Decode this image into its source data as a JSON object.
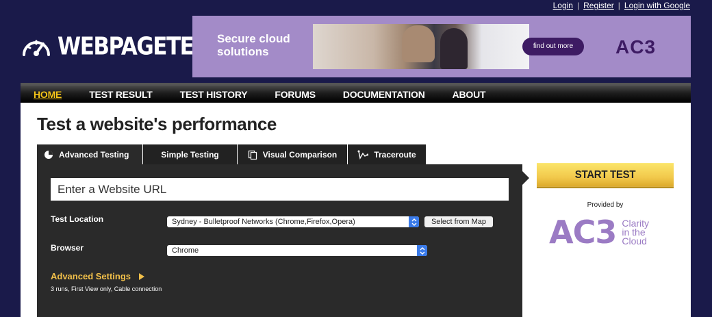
{
  "top_links": {
    "login": "Login",
    "register": "Register",
    "login_google": "Login with Google",
    "separator": "|"
  },
  "logo": {
    "text": "WEBPAGETEST"
  },
  "ad": {
    "headline_1": "Secure cloud",
    "headline_2": "solutions",
    "cta": "find out more",
    "brand": "AC3"
  },
  "nav": {
    "items": [
      {
        "label": "HOME",
        "active": true
      },
      {
        "label": "TEST RESULT"
      },
      {
        "label": "TEST HISTORY"
      },
      {
        "label": "FORUMS"
      },
      {
        "label": "DOCUMENTATION"
      },
      {
        "label": "ABOUT"
      }
    ]
  },
  "page": {
    "title": "Test a website's performance"
  },
  "tabs": [
    {
      "label": "Advanced Testing",
      "icon": "pie-chart-icon",
      "active": true
    },
    {
      "label": "Simple Testing"
    },
    {
      "label": "Visual Comparison",
      "icon": "documents-icon"
    },
    {
      "label": "Traceroute",
      "icon": "traceroute-icon"
    }
  ],
  "form": {
    "url_placeholder": "Enter a Website URL",
    "location_label": "Test Location",
    "location_value": "Sydney - Bulletproof Networks (Chrome,Firefox,Opera)",
    "map_button": "Select from Map",
    "browser_label": "Browser",
    "browser_value": "Chrome",
    "advanced_label": "Advanced Settings",
    "advanced_summary": "3 runs, First View only, Cable connection"
  },
  "sidebar": {
    "start_button": "START TEST",
    "provided_by": "Provided by",
    "sponsor_logo": "AC3",
    "sponsor_tag_1": "Clarity",
    "sponsor_tag_2": "in the",
    "sponsor_tag_3": "Cloud"
  },
  "colors": {
    "page_bg": "#1a1a4a",
    "nav_active": "#f5c518",
    "ad_bg": "#a38bc8",
    "ad_brand": "#3d1b63",
    "panel_bg": "#2a2a2a",
    "advanced_link": "#f2c04a",
    "start_button": "#f2c94c",
    "stepper": "#3a7bea",
    "sponsor": "#9b7bc4"
  }
}
